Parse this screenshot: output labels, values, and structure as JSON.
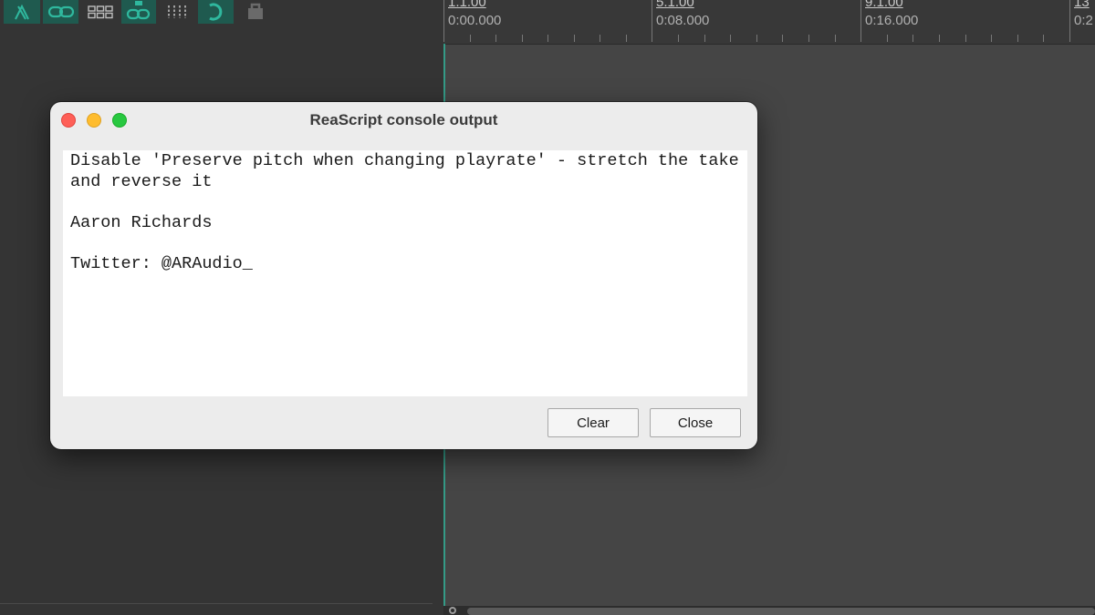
{
  "toolbar": {
    "icons": [
      "ripple-edit-icon",
      "link-icon",
      "grid-icon",
      "snap-link-icon",
      "metronome-icon",
      "loop-icon",
      "lock-icon"
    ],
    "accent_color": "#2fb89e"
  },
  "ruler": {
    "markers": [
      {
        "measure": "1.1.00",
        "time": "0:00.000"
      },
      {
        "measure": "5.1.00",
        "time": "0:08.000"
      },
      {
        "measure": "9.1.00",
        "time": "0:16.000"
      },
      {
        "measure": "13",
        "time": "0:2"
      }
    ]
  },
  "dialog": {
    "title": "ReaScript console output",
    "console_text": "Disable 'Preserve pitch when changing playrate' - stretch the take and reverse it\n\nAaron Richards\n\nTwitter: @ARAudio_",
    "clear_label": "Clear",
    "close_label": "Close"
  },
  "colors": {
    "traffic_close": "#fe5f57",
    "traffic_minimize": "#febc2e",
    "traffic_maximize": "#28c840"
  }
}
